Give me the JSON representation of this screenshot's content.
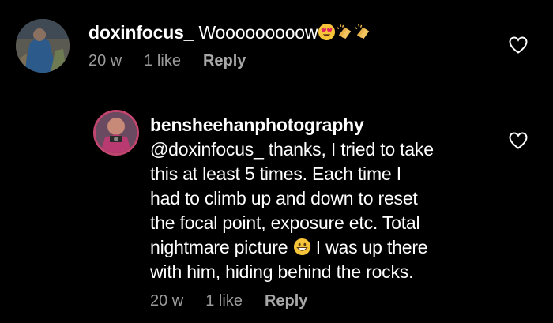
{
  "comments": [
    {
      "username": "doxinfocus_",
      "text": "Wooooooooow",
      "emoji_after": [
        "heart-eyes",
        "clap",
        "clap"
      ],
      "age": "20 w",
      "likes": "1 like",
      "reply_label": "Reply"
    },
    {
      "username": "bensheehanphotography",
      "text_lines": [
        "@doxinfocus_ thanks, I tried to take",
        "this at least 5 times. Each time I",
        "had to climb up and down to reset",
        "the focal point, exposure etc. Total",
        "nightmare picture",
        " I was up there",
        "with him, hiding behind the rocks."
      ],
      "inline_emoji": "grinning-face",
      "age": "20 w",
      "likes": "1 like",
      "reply_label": "Reply"
    }
  ],
  "icons": {
    "like": "heart-outline-icon"
  },
  "colors": {
    "background": "#000000",
    "text": "#ffffff",
    "meta": "#9a9a9a",
    "avatar_ring": "#c0466f"
  }
}
